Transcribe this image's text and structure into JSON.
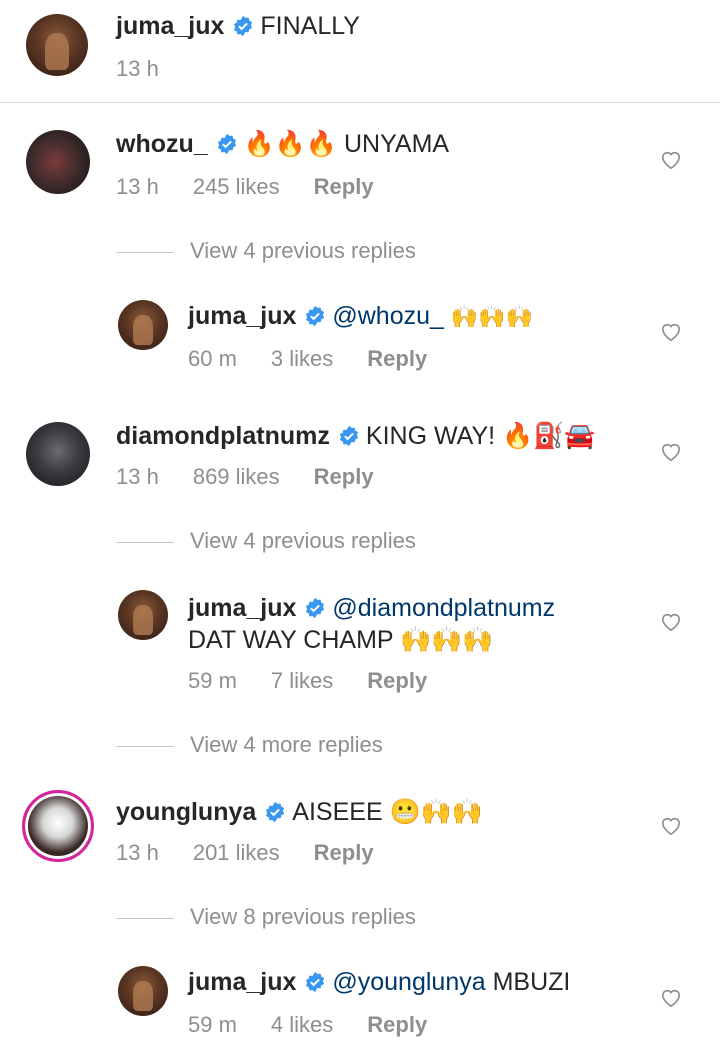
{
  "caption": {
    "user": "juma_jux",
    "text": "FINALLY",
    "time": "13 h"
  },
  "comments": [
    {
      "user": "whozu_",
      "text": "🔥🔥🔥 UNYAMA",
      "time": "13 h",
      "likes": "245 likes",
      "reply": "Reply",
      "view_replies": "View 4 previous replies",
      "reply_item": {
        "user": "juma_jux",
        "mention": "@whozu_",
        "text": "🙌🙌🙌",
        "time": "60 m",
        "likes": "3 likes",
        "reply": "Reply"
      }
    },
    {
      "user": "diamondplatnumz",
      "text": "KING WAY! 🔥⛽🚘",
      "time": "13 h",
      "likes": "869 likes",
      "reply": "Reply",
      "view_replies": "View 4 previous replies",
      "reply_item": {
        "user": "juma_jux",
        "mention": "@diamondplatnumz",
        "text": "DAT WAY CHAMP 🙌🙌🙌",
        "time": "59 m",
        "likes": "7 likes",
        "reply": "Reply"
      },
      "view_more": "View 4 more replies"
    },
    {
      "user": "younglunya",
      "text": "AISEEE 😬🙌🙌",
      "time": "13 h",
      "likes": "201 likes",
      "reply": "Reply",
      "view_replies": "View 8 previous replies",
      "reply_item": {
        "user": "juma_jux",
        "mention": "@younglunya",
        "text": "MBUZI",
        "time": "59 m",
        "likes": "4 likes",
        "reply": "Reply"
      }
    }
  ],
  "colors": {
    "verified": "#3897f0",
    "mention": "#00376b",
    "meta": "#8e8e8e"
  },
  "icons": {
    "verified": "verified-badge-icon",
    "like": "heart-outline-icon"
  }
}
